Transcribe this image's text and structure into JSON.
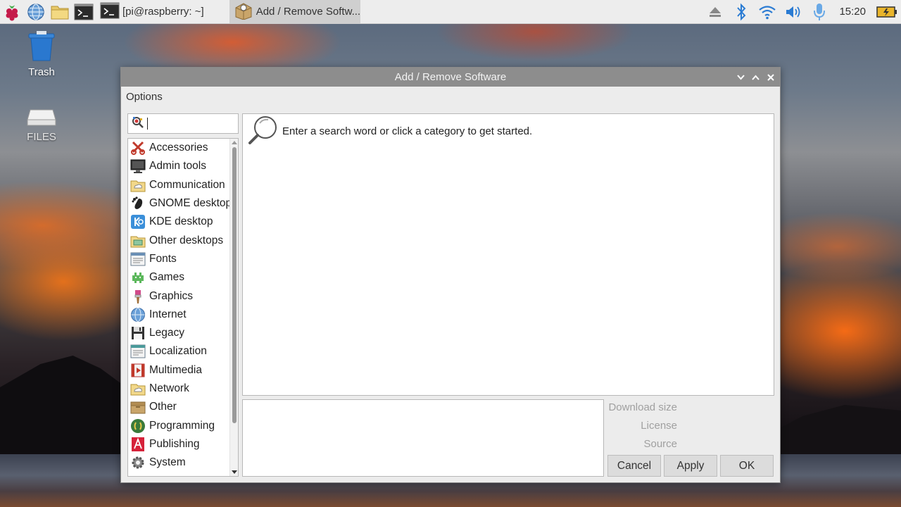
{
  "taskbar": {
    "tasks": [
      {
        "label": "[pi@raspberry: ~]"
      },
      {
        "label": "Add / Remove Softw..."
      }
    ],
    "clock": "15:20"
  },
  "desktop": {
    "icons": [
      {
        "label": "Trash"
      },
      {
        "label": "FILES"
      }
    ]
  },
  "window": {
    "title": "Add / Remove Software",
    "menu": {
      "options": "Options"
    },
    "search": {
      "value": ""
    },
    "hint": "Enter a search word or click a category to get started.",
    "categories": [
      {
        "label": "Accessories",
        "icon": "accessories-icon"
      },
      {
        "label": "Admin tools",
        "icon": "admin-tools-icon"
      },
      {
        "label": "Communication",
        "icon": "communication-icon"
      },
      {
        "label": "GNOME desktop",
        "icon": "gnome-icon"
      },
      {
        "label": "KDE desktop",
        "icon": "kde-icon"
      },
      {
        "label": "Other desktops",
        "icon": "other-desktops-icon"
      },
      {
        "label": "Fonts",
        "icon": "fonts-icon"
      },
      {
        "label": "Games",
        "icon": "games-icon"
      },
      {
        "label": "Graphics",
        "icon": "graphics-icon"
      },
      {
        "label": "Internet",
        "icon": "internet-icon"
      },
      {
        "label": "Legacy",
        "icon": "legacy-icon"
      },
      {
        "label": "Localization",
        "icon": "localization-icon"
      },
      {
        "label": "Multimedia",
        "icon": "multimedia-icon"
      },
      {
        "label": "Network",
        "icon": "network-icon"
      },
      {
        "label": "Other",
        "icon": "other-icon"
      },
      {
        "label": "Programming",
        "icon": "programming-icon"
      },
      {
        "label": "Publishing",
        "icon": "publishing-icon"
      },
      {
        "label": "System",
        "icon": "system-icon"
      }
    ],
    "info": {
      "download_size": "Download size",
      "license": "License",
      "source": "Source"
    },
    "buttons": {
      "cancel": "Cancel",
      "apply": "Apply",
      "ok": "OK"
    }
  }
}
